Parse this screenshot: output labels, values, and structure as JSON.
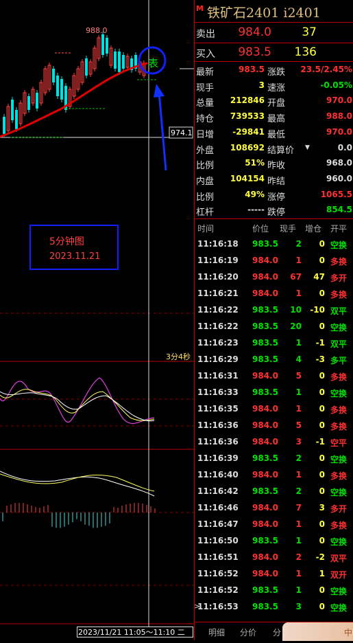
{
  "contract": {
    "marker": "M",
    "title": "铁矿石2401  i2401"
  },
  "quote": {
    "sell": {
      "label": "卖出",
      "price": "984.0",
      "vol": "37"
    },
    "buy": {
      "label": "买入",
      "price": "983.5",
      "vol": "136"
    }
  },
  "stats": [
    {
      "l1": "最新",
      "v1": "983.5",
      "c1": "red",
      "l2": "涨跌",
      "v2": "23.5/2.45%",
      "c2": "red"
    },
    {
      "l1": "现手",
      "v1": "3",
      "c1": "yellow",
      "l2": "速涨",
      "v2": "-0.05%",
      "c2": "green"
    },
    {
      "l1": "总量",
      "v1": "212846",
      "c1": "yellow",
      "l2": "开盘",
      "v2": "970.0",
      "c2": "red"
    },
    {
      "l1": "持仓",
      "v1": "739533",
      "c1": "yellow",
      "l2": "最高",
      "v2": "988.0",
      "c2": "red"
    },
    {
      "l1": "日增",
      "v1": "-29841",
      "c1": "yellow",
      "l2": "最低",
      "v2": "970.0",
      "c2": "red"
    },
    {
      "l1": "外盘",
      "v1": "108692",
      "c1": "yellow",
      "l2": "结算价",
      "v2": "0.0",
      "c2": "white"
    },
    {
      "l1": "比例",
      "v1": "51%",
      "c1": "yellow",
      "l2": "昨收",
      "v2": "968.0",
      "c2": "white"
    },
    {
      "l1": "内盘",
      "v1": "104154",
      "c1": "yellow",
      "l2": "昨结",
      "v2": "960.0",
      "c2": "white"
    },
    {
      "l1": "比例",
      "v1": "49%",
      "c1": "yellow",
      "l2": "涨停",
      "v2": "1065.5",
      "c2": "red"
    },
    {
      "l1": "杠杆",
      "v1": "-----",
      "c1": "white",
      "l2": "跌停",
      "v2": "854.5",
      "c2": "green"
    }
  ],
  "ticks_header": {
    "time": "时间",
    "price": "价位",
    "vol": "现手",
    "oi": "增仓",
    "type": "开平"
  },
  "ticks": [
    {
      "time": "11:16:18",
      "price": "983.5",
      "pc": "green",
      "vol": "2",
      "vc": "green",
      "oi": "0",
      "type": "空换",
      "tc": "green"
    },
    {
      "time": "11:16:19",
      "price": "984.0",
      "pc": "red",
      "vol": "1",
      "vc": "red",
      "oi": "0",
      "type": "多换",
      "tc": "red"
    },
    {
      "time": "11:16:20",
      "price": "984.0",
      "pc": "red",
      "vol": "67",
      "vc": "red",
      "oi": "47",
      "type": "多开",
      "tc": "red"
    },
    {
      "time": "11:16:21",
      "price": "984.0",
      "pc": "red",
      "vol": "1",
      "vc": "red",
      "oi": "0",
      "type": "多换",
      "tc": "red"
    },
    {
      "time": "11:16:22",
      "price": "983.5",
      "pc": "green",
      "vol": "10",
      "vc": "green",
      "oi": "-10",
      "type": "双平",
      "tc": "green"
    },
    {
      "time": "11:16:22",
      "price": "983.5",
      "pc": "green",
      "vol": "20",
      "vc": "green",
      "oi": "0",
      "type": "空换",
      "tc": "green"
    },
    {
      "time": "11:16:23",
      "price": "983.5",
      "pc": "green",
      "vol": "1",
      "vc": "green",
      "oi": "-1",
      "type": "双平",
      "tc": "green"
    },
    {
      "time": "11:16:29",
      "price": "983.5",
      "pc": "green",
      "vol": "4",
      "vc": "green",
      "oi": "-3",
      "type": "多平",
      "tc": "green"
    },
    {
      "time": "11:16:31",
      "price": "984.0",
      "pc": "red",
      "vol": "5",
      "vc": "red",
      "oi": "0",
      "type": "多换",
      "tc": "red"
    },
    {
      "time": "11:16:33",
      "price": "983.5",
      "pc": "green",
      "vol": "1",
      "vc": "green",
      "oi": "0",
      "type": "空换",
      "tc": "green"
    },
    {
      "time": "11:16:35",
      "price": "984.0",
      "pc": "red",
      "vol": "1",
      "vc": "red",
      "oi": "0",
      "type": "多换",
      "tc": "red"
    },
    {
      "time": "11:16:36",
      "price": "984.0",
      "pc": "red",
      "vol": "5",
      "vc": "red",
      "oi": "0",
      "type": "多换",
      "tc": "red"
    },
    {
      "time": "11:16:36",
      "price": "984.0",
      "pc": "red",
      "vol": "3",
      "vc": "red",
      "oi": "-1",
      "type": "空平",
      "tc": "red"
    },
    {
      "time": "11:16:39",
      "price": "983.5",
      "pc": "green",
      "vol": "2",
      "vc": "green",
      "oi": "0",
      "type": "空换",
      "tc": "green"
    },
    {
      "time": "11:16:40",
      "price": "984.0",
      "pc": "red",
      "vol": "1",
      "vc": "red",
      "oi": "0",
      "type": "多换",
      "tc": "red"
    },
    {
      "time": "11:16:42",
      "price": "983.5",
      "pc": "green",
      "vol": "2",
      "vc": "green",
      "oi": "0",
      "type": "空换",
      "tc": "green"
    },
    {
      "time": "11:16:46",
      "price": "984.0",
      "pc": "red",
      "vol": "7",
      "vc": "red",
      "oi": "3",
      "type": "多开",
      "tc": "red"
    },
    {
      "time": "11:16:47",
      "price": "984.0",
      "pc": "red",
      "vol": "1",
      "vc": "red",
      "oi": "0",
      "type": "多换",
      "tc": "red"
    },
    {
      "time": "11:16:50",
      "price": "983.5",
      "pc": "green",
      "vol": "1",
      "vc": "green",
      "oi": "0",
      "type": "空换",
      "tc": "green"
    },
    {
      "time": "11:16:51",
      "price": "984.0",
      "pc": "red",
      "vol": "2",
      "vc": "red",
      "oi": "-2",
      "type": "双平",
      "tc": "red"
    },
    {
      "time": "11:16:52",
      "price": "984.0",
      "pc": "red",
      "vol": "1",
      "vc": "red",
      "oi": "1",
      "type": "双开",
      "tc": "red"
    },
    {
      "time": "11:16:52",
      "price": "983.5",
      "pc": "green",
      "vol": "1",
      "vc": "green",
      "oi": "0",
      "type": "空换",
      "tc": "green"
    },
    {
      "time": "11:16:53",
      "price": "983.5",
      "pc": "green",
      "vol": "3",
      "vc": "green",
      "oi": "0",
      "type": "空换",
      "tc": "green"
    }
  ],
  "tabs": [
    "明细",
    "分价",
    "分"
  ],
  "chart": {
    "high_label": "988.0",
    "cursor_price": "974.1",
    "annotation_line1": "5分钟图",
    "annotation_line2": "2023.11.21",
    "countdown": "3分4秒",
    "date_range": "2023/11/21 11:05～11:10 二",
    "circle_char": "表",
    "ticker_tab": "中"
  }
}
